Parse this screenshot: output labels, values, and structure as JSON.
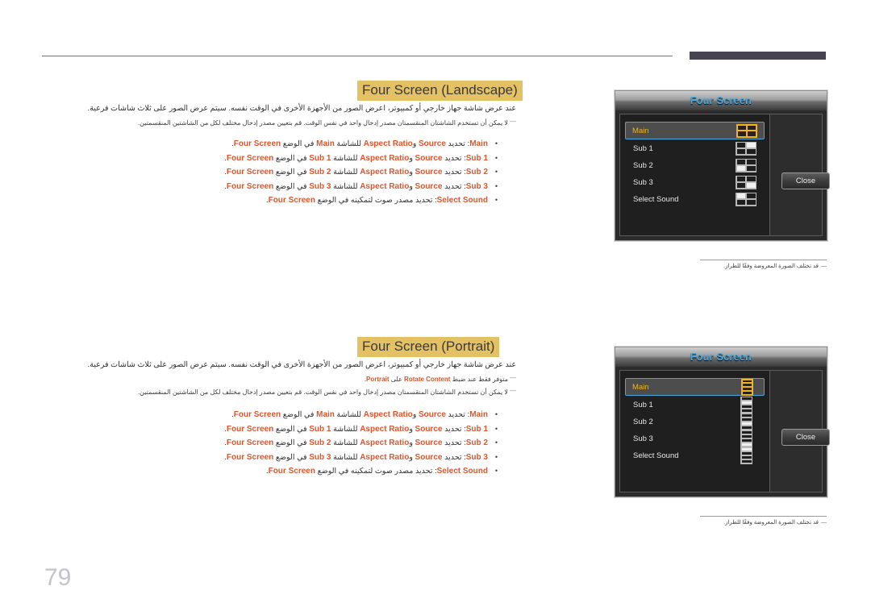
{
  "page": {
    "number": "79",
    "accent_heading_bg": "#e4c264",
    "accent_orange": "#e2552b",
    "osd_title_color": "#4aa8e0",
    "osd_select_color": "#f0b41f"
  },
  "sections": [
    {
      "id": "landscape",
      "heading": "Four Screen (Landscape)",
      "paragraph": "عند عرض شاشة جهاز خارجي أو كمبيوتر، اعرض الصور من الأجهزة الأخرى في الوقت نفسه. سيتم عرض الصور على ثلاث شاشات فرعية.",
      "notes": [
        {
          "dash": "―",
          "text": "لا يمكن أن تستخدم الشاشتان المنقسمتان مصدر إدخال واحد في نفس الوقت. قم بتعيين مصدر إدخال مختلف لكل من الشاشتين المنقسمتين."
        }
      ],
      "bullets": [
        {
          "term": "Main",
          "ar_pre": ": تحديد ",
          "t1": "Source",
          "mid": " و",
          "t2": "Aspect Ratio",
          "ar_mid": " للشاشة ",
          "t3": "Main",
          "ar_post": " في الوضع ",
          "t4": "Four Screen",
          "tail": "."
        },
        {
          "term": "Sub 1",
          "ar_pre": ": تحديد ",
          "t1": "Source",
          "mid": " و",
          "t2": "Aspect Ratio",
          "ar_mid": " للشاشة ",
          "t3": "Sub 1",
          "ar_post": " في الوضع ",
          "t4": "Four Screen",
          "tail": "."
        },
        {
          "term": "Sub 2",
          "ar_pre": ": تحديد ",
          "t1": "Source",
          "mid": " و",
          "t2": "Aspect Ratio",
          "ar_mid": " للشاشة ",
          "t3": "Sub 2",
          "ar_post": " في الوضع ",
          "t4": "Four Screen",
          "tail": "."
        },
        {
          "term": "Sub 3",
          "ar_pre": ": تحديد ",
          "t1": "Source",
          "mid": " و",
          "t2": "Aspect Ratio",
          "ar_mid": " للشاشة ",
          "t3": "Sub 3",
          "ar_post": " في الوضع ",
          "t4": "Four Screen",
          "tail": "."
        },
        {
          "term": "Select Sound",
          "ar_pre": ": تحديد مصدر صوت لتمكينه في الوضع ",
          "t1": "",
          "mid": "",
          "t2": "",
          "ar_mid": "",
          "t3": "",
          "ar_post": "",
          "t4": "Four Screen",
          "tail": "."
        }
      ],
      "osd": {
        "title": "Four Screen",
        "icon_style": "quad",
        "rows": [
          {
            "label": "Main",
            "selected": true,
            "cells": [
              1,
              1,
              1,
              1
            ]
          },
          {
            "label": "Sub 1",
            "selected": false,
            "cells": [
              0,
              1,
              0,
              0
            ]
          },
          {
            "label": "Sub 2",
            "selected": false,
            "cells": [
              0,
              0,
              1,
              0
            ]
          },
          {
            "label": "Sub 3",
            "selected": false,
            "cells": [
              0,
              0,
              0,
              1
            ]
          },
          {
            "label": "Select Sound",
            "selected": false,
            "cells": [
              1,
              0,
              0,
              0
            ]
          }
        ],
        "close_label": "Close"
      },
      "caption": {
        "dash": "―",
        "text": "قد تختلف الصورة المعروضة وفقًا للطراز."
      }
    },
    {
      "id": "portrait",
      "heading": "Four Screen (Portrait)",
      "paragraph": "عند عرض شاشة جهاز خارجي أو كمبيوتر، اعرض الصور من الأجهزة الأخرى في الوقت نفسه. سيتم عرض الصور على ثلاث شاشات فرعية.",
      "notes": [
        {
          "dash": "―",
          "pre": "متوفر فقط عند ضبط ",
          "b1": "Rotate Content",
          "mid": " على ",
          "b2": "Portrait",
          "post": "."
        },
        {
          "dash": "―",
          "text": "لا يمكن أن تستخدم الشاشتان المنقسمتان مصدر إدخال واحد في نفس الوقت. قم بتعيين مصدر إدخال مختلف لكل من الشاشتين المنقسمتين."
        }
      ],
      "bullets": [
        {
          "term": "Main",
          "ar_pre": ": تحديد ",
          "t1": "Source",
          "mid": " و",
          "t2": "Aspect Ratio",
          "ar_mid": " للشاشة ",
          "t3": "Main",
          "ar_post": " في الوضع ",
          "t4": "Four Screen",
          "tail": "."
        },
        {
          "term": "Sub 1",
          "ar_pre": ": تحديد ",
          "t1": "Source",
          "mid": " و",
          "t2": "Aspect Ratio",
          "ar_mid": " للشاشة ",
          "t3": "Sub 1",
          "ar_post": " في الوضع ",
          "t4": "Four Screen",
          "tail": "."
        },
        {
          "term": "Sub 2",
          "ar_pre": ": تحديد ",
          "t1": "Source",
          "mid": " و",
          "t2": "Aspect Ratio",
          "ar_mid": " للشاشة ",
          "t3": "Sub 2",
          "ar_post": " في الوضع ",
          "t4": "Four Screen",
          "tail": "."
        },
        {
          "term": "Sub 3",
          "ar_pre": ": تحديد ",
          "t1": "Source",
          "mid": " و",
          "t2": "Aspect Ratio",
          "ar_mid": " للشاشة ",
          "t3": "Sub 3",
          "ar_post": " في الوضع ",
          "t4": "Four Screen",
          "tail": "."
        },
        {
          "term": "Select Sound",
          "ar_pre": ": تحديد مصدر صوت لتمكينه في الوضع ",
          "t1": "",
          "mid": "",
          "t2": "",
          "ar_mid": "",
          "t3": "",
          "ar_post": "",
          "t4": "Four Screen",
          "tail": "."
        }
      ],
      "osd": {
        "title": "Four Screen",
        "icon_style": "stripe",
        "rows": [
          {
            "label": "Main",
            "selected": true,
            "cells": [
              1,
              1,
              1,
              1
            ]
          },
          {
            "label": "Sub 1",
            "selected": false,
            "cells": [
              0,
              1,
              0,
              0
            ]
          },
          {
            "label": "Sub 2",
            "selected": false,
            "cells": [
              0,
              0,
              1,
              0
            ]
          },
          {
            "label": "Sub 3",
            "selected": false,
            "cells": [
              0,
              0,
              0,
              1
            ]
          },
          {
            "label": "Select Sound",
            "selected": false,
            "cells": [
              1,
              0,
              0,
              0
            ]
          }
        ],
        "close_label": "Close"
      },
      "caption": {
        "dash": "―",
        "text": "قد تختلف الصورة المعروضة وفقًا للطراز."
      }
    }
  ]
}
